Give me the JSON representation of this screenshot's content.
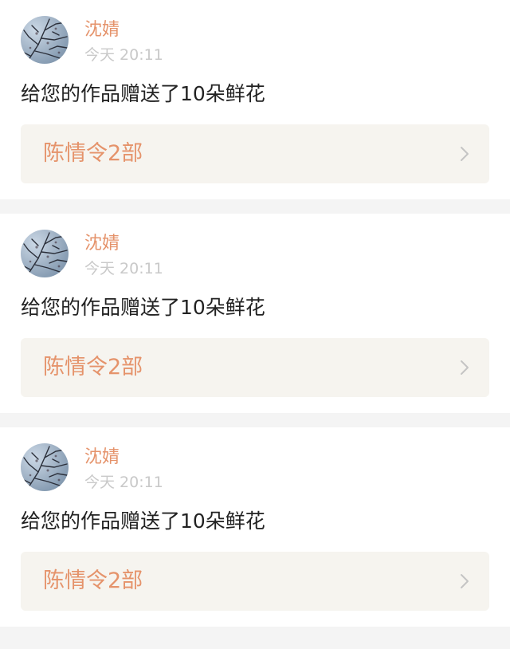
{
  "notifications": [
    {
      "user_name": "沈婧",
      "time": "今天 20:11",
      "message": "给您的作品赠送了10朵鲜花",
      "work_title": "陈情令2部",
      "avatar_icon": "tree-branches-sky-avatar",
      "arrow_icon": "chevron-right-icon"
    },
    {
      "user_name": "沈婧",
      "time": "今天 20:11",
      "message": "给您的作品赠送了10朵鲜花",
      "work_title": "陈情令2部",
      "avatar_icon": "tree-branches-sky-avatar",
      "arrow_icon": "chevron-right-icon"
    },
    {
      "user_name": "沈婧",
      "time": "今天 20:11",
      "message": "给您的作品赠送了10朵鲜花",
      "work_title": "陈情令2部",
      "avatar_icon": "tree-branches-sky-avatar",
      "arrow_icon": "chevron-right-icon"
    }
  ],
  "colors": {
    "accent": "#e5936b",
    "time": "#c9c9c9",
    "message": "#222222",
    "card_link_bg": "#f6f4ef",
    "page_bg": "#f4f4f4"
  }
}
